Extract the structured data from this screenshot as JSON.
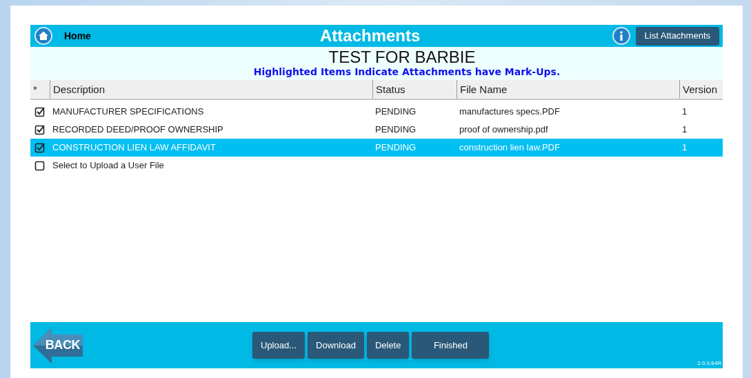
{
  "header": {
    "home_label": "Home",
    "title": "Attachments",
    "list_button": "List Attachments"
  },
  "subheader": {
    "title": "TEST FOR BARBIE",
    "note": "Highlighted Items Indicate Attachments have Mark-Ups."
  },
  "table": {
    "columns": [
      "*",
      "Description",
      "Status",
      "File Name",
      "Version"
    ],
    "rows": [
      {
        "checked": true,
        "selected": false,
        "description": "MANUFACTURER SPECIFICATIONS",
        "status": "PENDING",
        "file_name": "manufactures specs.PDF",
        "version": "1"
      },
      {
        "checked": true,
        "selected": false,
        "description": "RECORDED DEED/PROOF OWNERSHIP",
        "status": "PENDING",
        "file_name": "proof of ownership.pdf",
        "version": "1"
      },
      {
        "checked": true,
        "selected": true,
        "description": "CONSTRUCTION LIEN LAW AFFIDAVIT",
        "status": "PENDING",
        "file_name": "construction lien law.PDF",
        "version": "1"
      }
    ],
    "upload_option": {
      "checked": false,
      "label": "Select to Upload a User File"
    }
  },
  "footer": {
    "back": "BACK",
    "buttons": [
      "Upload...",
      "Download",
      "Delete",
      "Finished"
    ],
    "version": "2.0.0.64R"
  }
}
